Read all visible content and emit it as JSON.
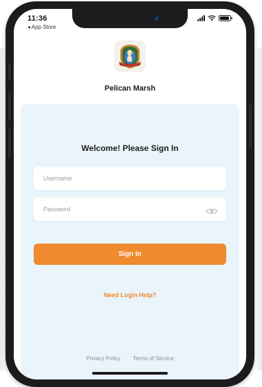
{
  "status_bar": {
    "time": "11:36",
    "back_label": "◂ App Store"
  },
  "brand": {
    "name": "Pelican Marsh"
  },
  "login": {
    "heading": "Welcome! Please Sign In",
    "username_placeholder": "Username",
    "password_placeholder": "Password",
    "sign_in_label": "Sign In",
    "help_label": "Need Login Help?"
  },
  "footer": {
    "privacy_label": "Privacy Policy",
    "terms_label": "Terms of Service"
  },
  "colors": {
    "accent": "#f08a2e",
    "panel_background": "#eaf4fb",
    "phone_frame": "#1c1c1e"
  },
  "icons": {
    "logo": "pelican-crest-logo",
    "password_toggle": "eye-icon",
    "wifi": "wifi-icon",
    "battery": "battery-icon",
    "signal": "signal-icon"
  }
}
